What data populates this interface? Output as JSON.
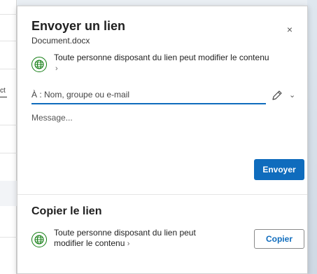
{
  "background": {
    "fragment_text": "ct"
  },
  "send_section": {
    "title": "Envoyer un lien",
    "file_name": "Document.docx",
    "permission_text": "Toute personne disposant du lien peut modifier le contenu",
    "permission_chevron": "›",
    "to_placeholder": "À : Nom, groupe ou e-mail",
    "to_value": "",
    "message_placeholder": "Message...",
    "send_label": "Envoyer",
    "close_symbol": "×",
    "options_chevron": "⌄"
  },
  "copy_section": {
    "title": "Copier le lien",
    "permission_line1": "Toute personne disposant du lien peut",
    "permission_line2": "modifier le contenu",
    "permission_chevron": "›",
    "copy_label": "Copier"
  },
  "colors": {
    "accent": "#0f6cbd",
    "globe": "#107c10"
  },
  "icons": {
    "close": "close-icon",
    "globe": "globe-icon",
    "pencil": "pencil-icon",
    "chevron": "chevron-down-icon"
  }
}
